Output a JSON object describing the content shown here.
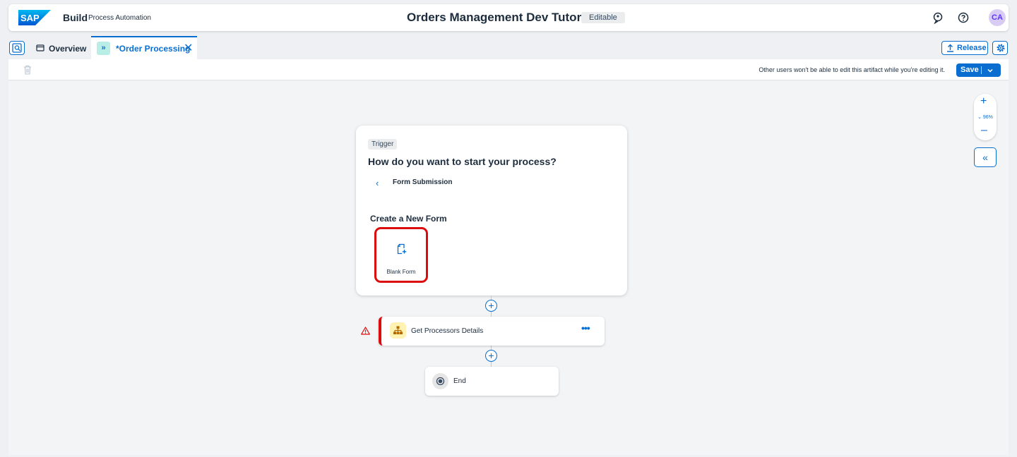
{
  "shellbar": {
    "logo": "SAP",
    "brand": "Build",
    "product": "Process Automation",
    "project_title": "Orders Management Dev Tutorial",
    "status": "Editable",
    "icons": [
      "notifications-icon",
      "help-icon"
    ],
    "avatar_initials": "CA"
  },
  "tabs": [
    {
      "label": "Overview",
      "icon": "overview-icon",
      "active": false
    },
    {
      "label": "*Order Processing",
      "icon": "process-icon",
      "active": true
    }
  ],
  "tab_actions": {
    "release_label": "Release"
  },
  "toolbar": {
    "lock_note": "Other users won't be able to edit this artifact while you're editing it.",
    "save_label": "Save"
  },
  "zoom": {
    "level": "96%"
  },
  "trigger_card": {
    "tag": "Trigger",
    "question": "How do you want to start your process?",
    "selection": "Form Submission",
    "section_title": "Create a New Form",
    "option_label": "Blank Form"
  },
  "steps": [
    {
      "label": "Get Processors Details",
      "status": "error"
    },
    {
      "label": "End"
    }
  ],
  "colors": {
    "accent": "#0a6ed1",
    "error": "#dc0c0c",
    "canvas_bg": "#f3f4f6"
  }
}
